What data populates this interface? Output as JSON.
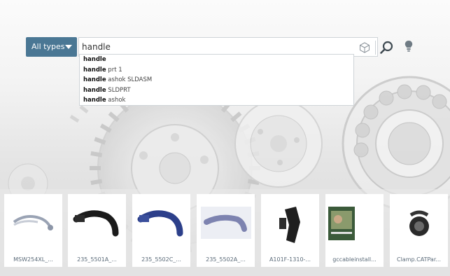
{
  "search": {
    "type_label": "All types",
    "query": "handle",
    "placeholder": ""
  },
  "icons": {
    "type_caret": "caret-down-icon",
    "cube": "cube-icon",
    "search": "magnifier-icon",
    "bulb": "lightbulb-icon"
  },
  "suggestions": [
    {
      "bold": "handle",
      "rest": ""
    },
    {
      "bold": "handle",
      "rest": " prt 1"
    },
    {
      "bold": "handle",
      "rest": " ashok SLDASM"
    },
    {
      "bold": "handle",
      "rest": " SLDPRT"
    },
    {
      "bold": "handle",
      "rest": " ashok"
    }
  ],
  "results": [
    {
      "caption": "MSW254XL_..."
    },
    {
      "caption": "235_5501A_..."
    },
    {
      "caption": "235_5502C_..."
    },
    {
      "caption": "235_5502A_..."
    },
    {
      "caption": "A101F-1310-..."
    },
    {
      "caption": "gccableinstall..."
    },
    {
      "caption": "Clamp.CATPar..."
    }
  ],
  "colors": {
    "accent": "#4a7794",
    "caption": "#5a6a78"
  }
}
